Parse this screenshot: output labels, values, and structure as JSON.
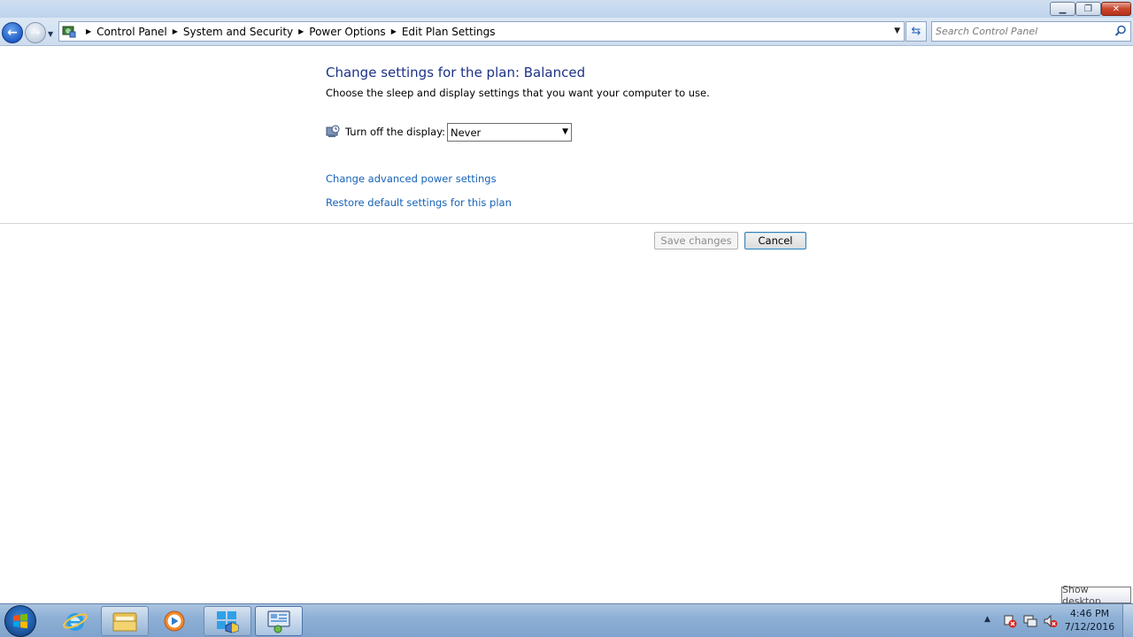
{
  "window": {
    "controls": {
      "minimize_icon": "minimize-icon",
      "restore_icon": "restore-icon",
      "close_icon": "close-icon"
    }
  },
  "address_bar": {
    "breadcrumbs": [
      "Control Panel",
      "System and Security",
      "Power Options",
      "Edit Plan Settings"
    ]
  },
  "search": {
    "placeholder": "Search Control Panel"
  },
  "page": {
    "title": "Change settings for the plan: Balanced",
    "subtitle": "Choose the sleep and display settings that you want your computer to use.",
    "display_label": "Turn off the display:",
    "display_value": "Never",
    "links": {
      "advanced": "Change advanced power settings",
      "restore": "Restore default settings for this plan"
    },
    "buttons": {
      "save": "Save changes",
      "cancel": "Cancel"
    }
  },
  "tooltip": {
    "text": "Show desktop"
  },
  "taskbar": {
    "clock_time": "4:46 PM",
    "clock_date": "7/12/2016"
  },
  "colors": {
    "title_blue": "#1e3287",
    "link_blue": "#1662b7",
    "taskbar": "#8eb0d6"
  }
}
